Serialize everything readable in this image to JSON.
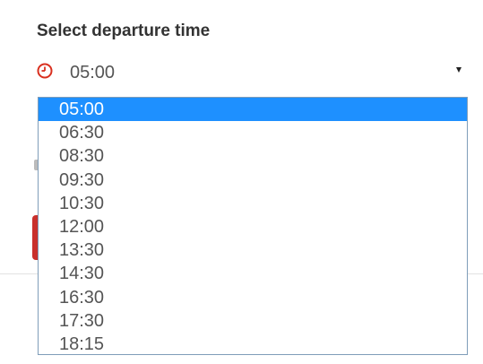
{
  "form": {
    "heading": "Select departure time",
    "select": {
      "icon": "clock-icon",
      "selected_value": "05:00",
      "caret_icon": "caret-down-icon"
    }
  },
  "dropdown": {
    "options": [
      "05:00",
      "06:30",
      "08:30",
      "09:30",
      "10:30",
      "12:00",
      "13:30",
      "14:30",
      "16:30",
      "17:30",
      "18:15"
    ],
    "highlighted_option": "05:00"
  },
  "colors": {
    "accent_red": "#d9301f",
    "highlight_blue": "#1e90ff",
    "button_red": "#c9302c"
  }
}
